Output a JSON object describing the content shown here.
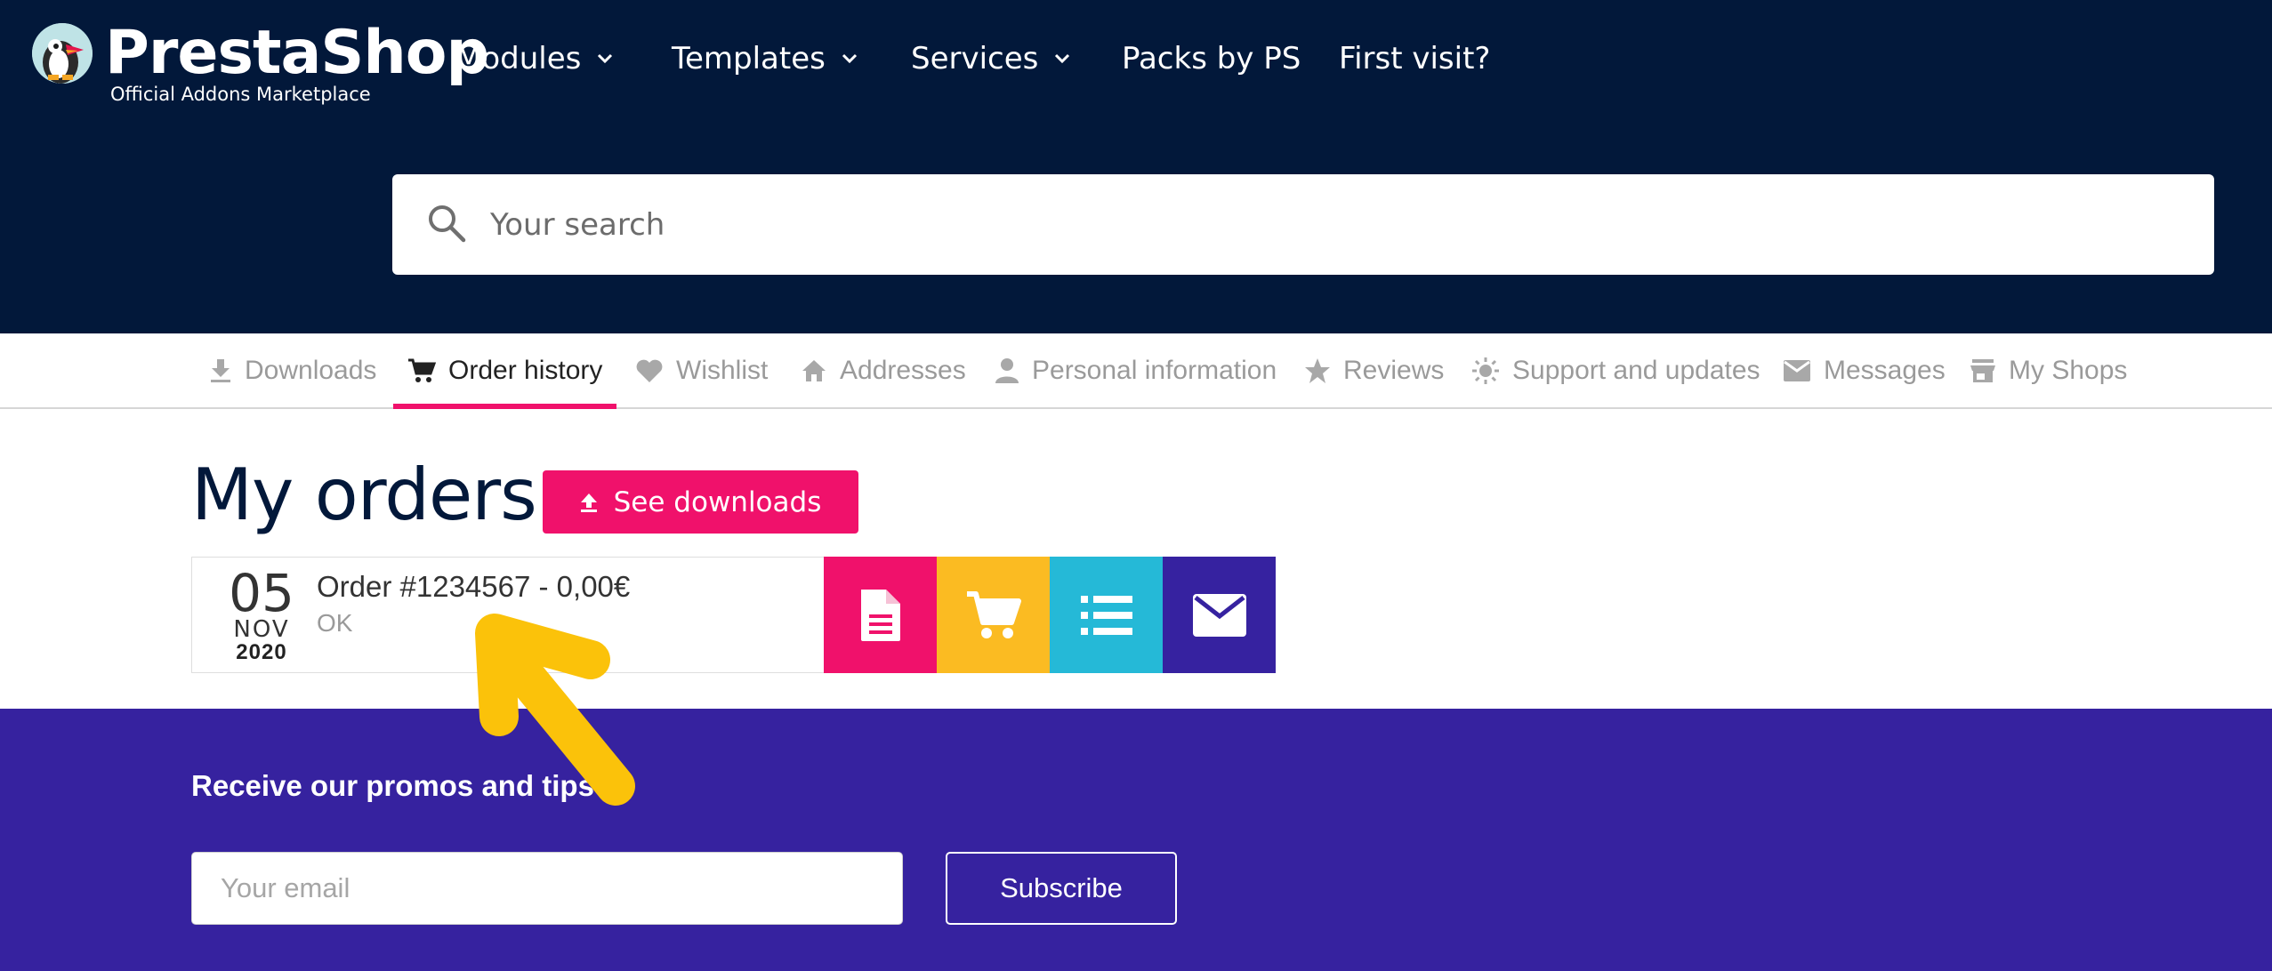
{
  "brand": {
    "name": "PrestaShop",
    "tagline": "Official Addons Marketplace"
  },
  "topnav": {
    "items": [
      {
        "label": "Modules",
        "dropdown": true
      },
      {
        "label": "Templates",
        "dropdown": true
      },
      {
        "label": "Services",
        "dropdown": true
      },
      {
        "label": "Packs by PS",
        "dropdown": false
      },
      {
        "label": "First visit?",
        "dropdown": false
      }
    ]
  },
  "search": {
    "placeholder": "Your search"
  },
  "tabs": [
    {
      "label": "Downloads",
      "icon": "download-icon",
      "active": false
    },
    {
      "label": "Order history",
      "icon": "cart-icon",
      "active": true
    },
    {
      "label": "Wishlist",
      "icon": "heart-icon",
      "active": false
    },
    {
      "label": "Addresses",
      "icon": "home-icon",
      "active": false
    },
    {
      "label": "Personal information",
      "icon": "person-icon",
      "active": false
    },
    {
      "label": "Reviews",
      "icon": "star-icon",
      "active": false
    },
    {
      "label": "Support and updates",
      "icon": "sun-icon",
      "active": false
    },
    {
      "label": "Messages",
      "icon": "mail-icon",
      "active": false
    },
    {
      "label": "My Shops",
      "icon": "store-icon",
      "active": false
    }
  ],
  "main": {
    "title": "My orders",
    "see_downloads_label": "See downloads"
  },
  "order": {
    "day": "05",
    "month": "NOV",
    "year": "2020",
    "title": "Order #1234567 - 0,00€",
    "status": "OK",
    "actions": [
      "invoice-icon",
      "cart-icon",
      "list-icon",
      "mail-icon"
    ]
  },
  "footer": {
    "promo_heading": "Receive our promos and tips",
    "email_placeholder": "Your email",
    "subscribe_label": "Subscribe"
  },
  "colors": {
    "header_bg": "#02183a",
    "accent_pink": "#f0116b",
    "accent_yellow": "#fbbb22",
    "accent_cyan": "#25b9d7",
    "accent_purple": "#36229f",
    "annotation_arrow": "#fbc20a"
  }
}
